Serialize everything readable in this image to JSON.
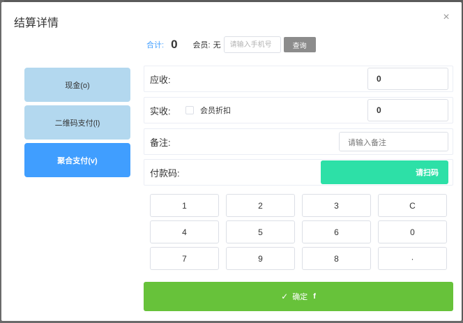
{
  "dialog": {
    "title": "结算详情",
    "close_icon": "close-icon",
    "close_glyph": "×"
  },
  "summary": {
    "total_label": "合计:",
    "total_value": "0",
    "member_label": "会员:",
    "member_value": "无",
    "phone_placeholder": "请输入手机号",
    "query_label": "查询"
  },
  "payment_methods": [
    {
      "label": "现金(o)",
      "selected": false
    },
    {
      "label": "二维码支付(l)",
      "selected": false
    },
    {
      "label": "聚合支付(v)",
      "selected": true
    }
  ],
  "fields": {
    "receivable_label": "应收:",
    "receivable_value": "0",
    "received_label": "实收:",
    "member_discount_label": "会员折扣",
    "member_discount_checked": false,
    "received_value": "0",
    "remark_label": "备注:",
    "remark_placeholder": "请输入备注",
    "paycode_label": "付款码:",
    "scan_label": "请扫码"
  },
  "keypad": {
    "keys": [
      "1",
      "2",
      "3",
      "C",
      "4",
      "5",
      "6",
      "0",
      "7",
      "9",
      "8",
      "·"
    ]
  },
  "confirm": {
    "icon": "check-icon",
    "icon_glyph": "✓",
    "label": "确定",
    "shortcut": "f"
  },
  "colors": {
    "accent": "#409eff",
    "method_inactive": "#b3d8ef",
    "scan": "#2de0a7",
    "confirm": "#67c23a"
  }
}
